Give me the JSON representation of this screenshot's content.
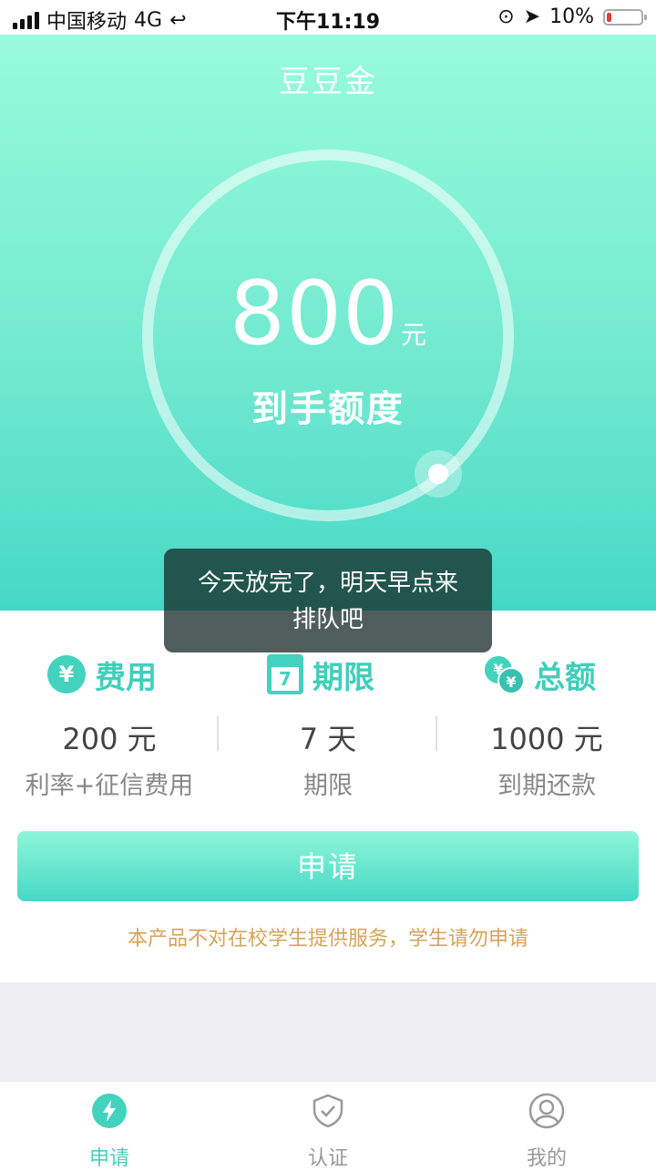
{
  "status_bar": {
    "carrier": "中国移动",
    "network": "4G",
    "time": "下午11:19",
    "battery": "10%",
    "battery_level": 0.1
  },
  "header": {
    "title": "豆豆金"
  },
  "quota": {
    "amount": "800",
    "unit": "元",
    "label": "到手额度"
  },
  "toast": {
    "line1": "今天放完了，明天早点来",
    "line2": "排队吧"
  },
  "info": {
    "fee": {
      "heading": "费用",
      "value": "200 元",
      "label": "利率+征信费用"
    },
    "term": {
      "heading": "期限",
      "value": "7 天",
      "label": "期限",
      "calendar_number": "7"
    },
    "total": {
      "heading": "总额",
      "value": "1000 元",
      "label": "到期还款"
    }
  },
  "apply_button": {
    "label": "申请"
  },
  "notice": "本产品不对在校学生提供服务，学生请勿申请",
  "tabs": [
    {
      "label": "申请",
      "icon": "lightning-icon",
      "active": true
    },
    {
      "label": "认证",
      "icon": "shield-check-icon",
      "active": false
    },
    {
      "label": "我的",
      "icon": "user-icon",
      "active": false
    }
  ],
  "colors": {
    "accent": "#43d2bd",
    "notice": "#d6a35b",
    "tab_inactive": "#999999"
  }
}
